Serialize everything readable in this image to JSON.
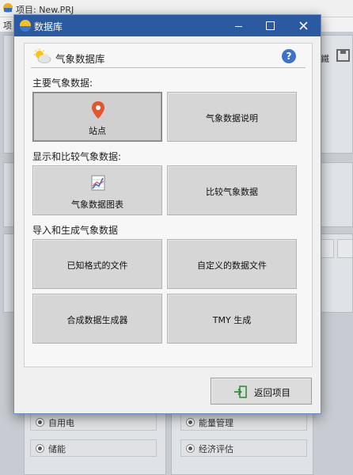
{
  "background_app": {
    "title": "项目: New.PRJ",
    "menu_first": "项",
    "right_partial_label": "鐵",
    "options": [
      {
        "label": "自用电"
      },
      {
        "label": "能量管理"
      },
      {
        "label": "储能"
      },
      {
        "label": "经济评估"
      }
    ]
  },
  "dialog": {
    "title": "数据库",
    "header_title": "气象数据库",
    "help_symbol": "?",
    "sections": [
      {
        "label": "主要气象数据:",
        "buttons": [
          {
            "label": "站点",
            "icon": "location-pin-icon",
            "selected": true
          },
          {
            "label": "气象数据说明",
            "selected": false
          }
        ]
      },
      {
        "label": "显示和比较气象数据:",
        "buttons": [
          {
            "label": "气象数据图表",
            "icon": "chart-icon",
            "selected": false
          },
          {
            "label": "比较气象数据",
            "selected": false
          }
        ]
      },
      {
        "label": "导入和生成气象数据",
        "buttons": [
          {
            "label": "已知格式的文件"
          },
          {
            "label": "自定义的数据文件"
          },
          {
            "label": "合成数据生成器"
          },
          {
            "label": "TMY 生成"
          }
        ]
      }
    ],
    "return_label": "返回项目"
  },
  "colors": {
    "titlebar": "#2c5aa0",
    "tile": "#d6d6d6",
    "pin": "#e4572e",
    "help": "#3d73c7"
  }
}
